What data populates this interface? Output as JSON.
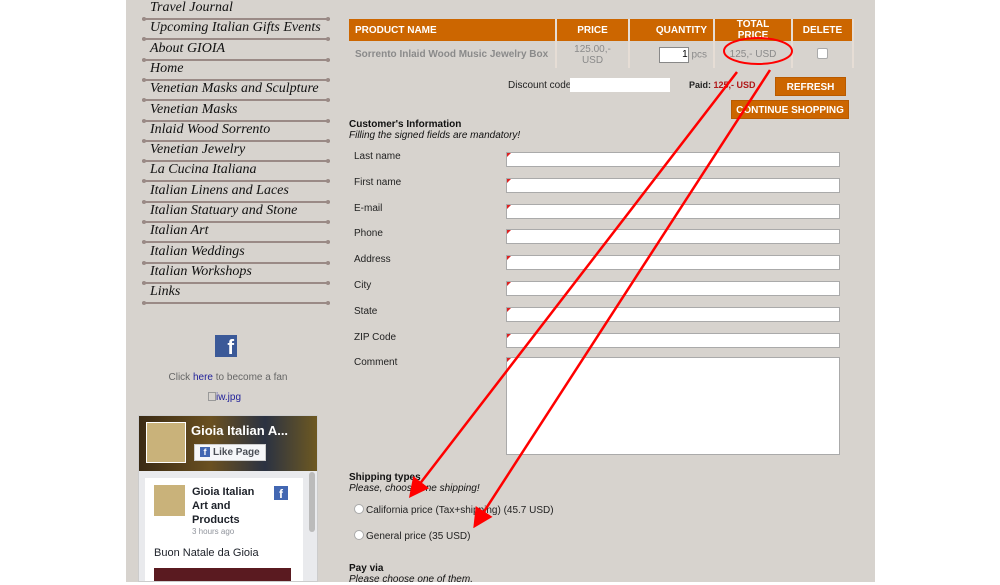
{
  "sidebar": {
    "items": [
      "Travel Journal",
      "Upcoming Italian Gifts Events",
      "About GIOIA",
      "Home",
      "Venetian Masks and Sculpture",
      "Venetian Masks",
      "Inlaid Wood Sorrento",
      "Venetian Jewelry",
      "La Cucina Italiana",
      "Italian Linens and Laces",
      "Italian Statuary and Stone",
      "Italian Art",
      "Italian Weddings",
      "Italian Workshops",
      "Links"
    ],
    "fan_prefix": "Click ",
    "fan_link": "here",
    "fan_suffix": " to become a fan",
    "image_alt": "iw.jpg",
    "fb_widget": {
      "page_name": "Gioia Italian A...",
      "like_button": "Like Page",
      "post_author": "Gioia Italian Art and Products",
      "post_time": "3 hours ago",
      "post_text": "Buon Natale da Gioia"
    }
  },
  "cart": {
    "headers": [
      "PRODUCT NAME",
      "PRICE",
      "QUANTITY",
      "TOTAL PRICE",
      "DELETE"
    ],
    "rows": [
      {
        "name": "Sorrento Inlaid Wood Music Jewelry Box",
        "price": "125.00,- USD",
        "quantity": "1",
        "unit": "pcs",
        "total": "125,- USD"
      }
    ],
    "discount_label": "Discount code",
    "discount_value": "",
    "paid_label": "Paid:",
    "paid_value": "125,- USD",
    "refresh": "REFRESH",
    "continue": "CONTINUE SHOPPING"
  },
  "customer": {
    "title": "Customer's Information",
    "note": "Filling the signed fields are mandatory!",
    "fields": [
      "Last name",
      "First name",
      "E-mail",
      "Phone",
      "Address",
      "City",
      "State",
      "ZIP Code"
    ],
    "comment": "Comment"
  },
  "shipping": {
    "title": "Shipping types",
    "note": "Please, choose one shipping!",
    "options": [
      "California price (Tax+shipping) (45.7 USD)",
      "General price (35 USD)"
    ]
  },
  "pay": {
    "title": "Pay via",
    "note": "Please choose one of them."
  },
  "colors": {
    "accent": "#cc6600",
    "annotation": "#ff0000"
  }
}
